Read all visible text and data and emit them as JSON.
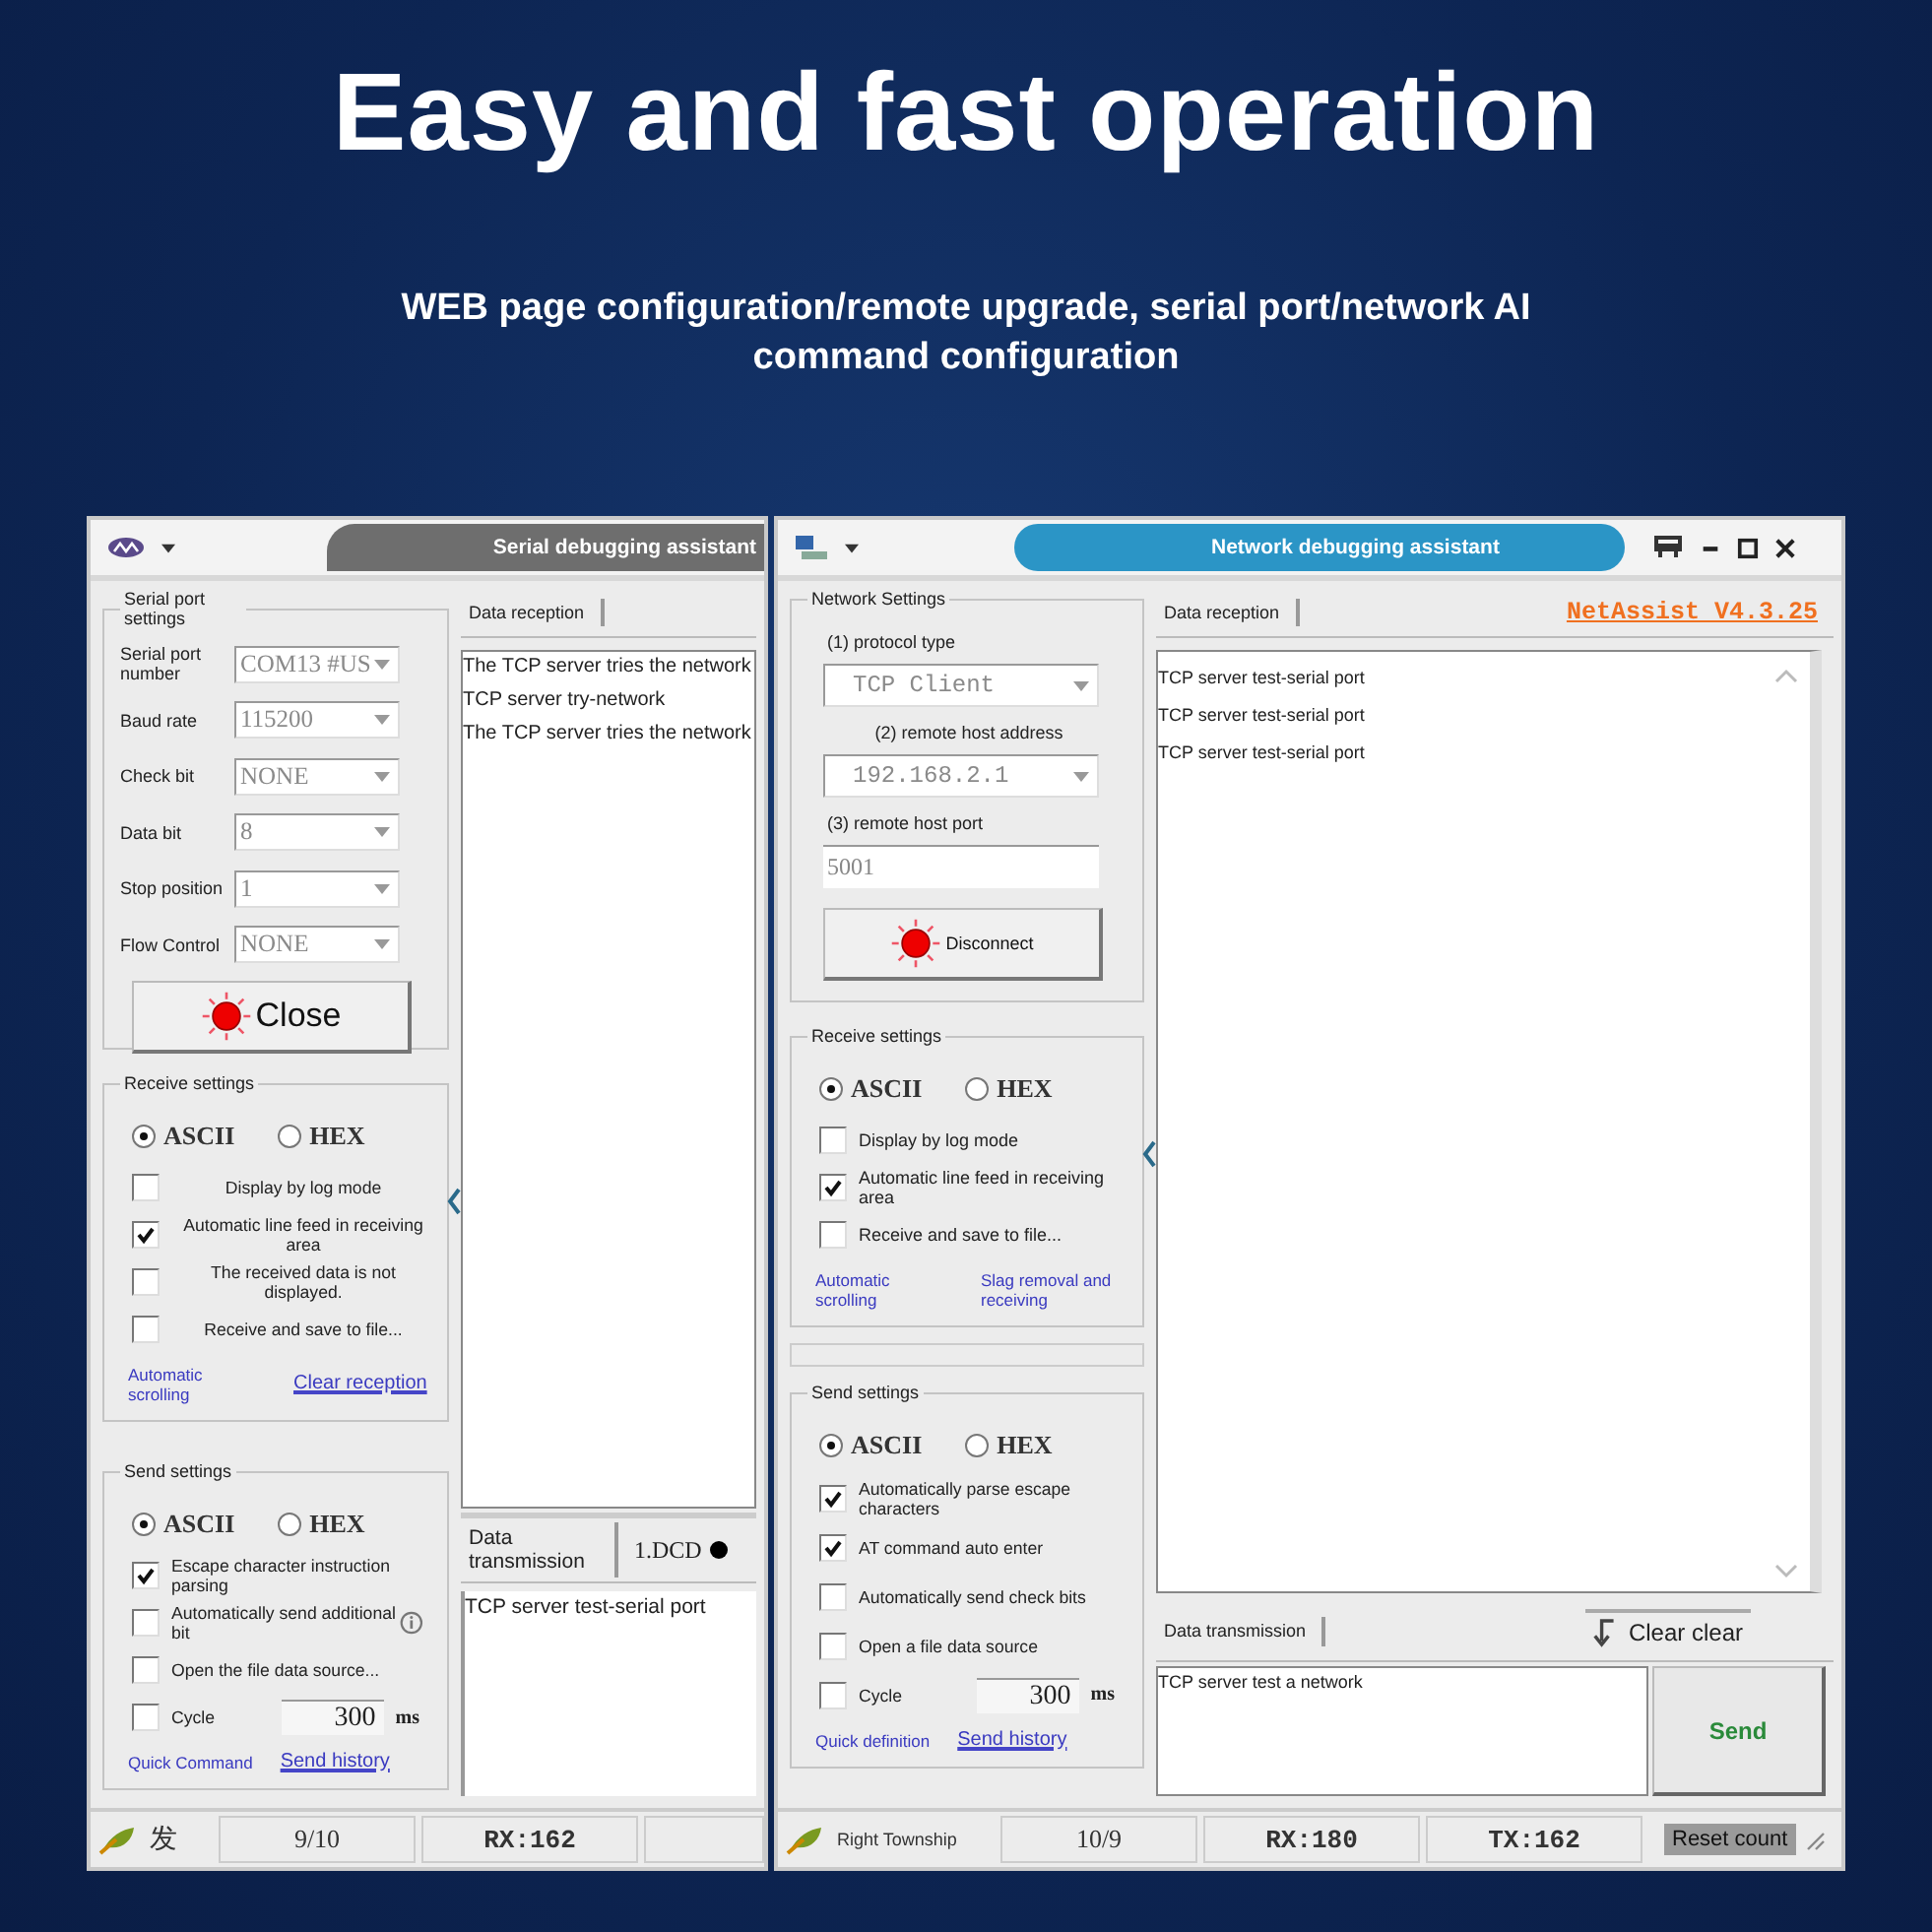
{
  "headline": "Easy and fast operation",
  "subtitle": "WEB page configuration/remote upgrade, serial port/network AI command configuration",
  "serial_window": {
    "title": "Serial debugging assistant",
    "port_settings": {
      "legend": "Serial port settings",
      "fields": [
        {
          "label": "Serial port number",
          "value": "COM13 #US"
        },
        {
          "label": "Baud rate",
          "value": "115200"
        },
        {
          "label": "Check bit",
          "value": "NONE"
        },
        {
          "label": "Data bit",
          "value": "8"
        },
        {
          "label": "Stop position",
          "value": "1"
        },
        {
          "label": "Flow Control",
          "value": "NONE"
        }
      ],
      "button": "Close"
    },
    "receive_settings": {
      "legend": "Receive settings",
      "modes": [
        {
          "label": "ASCII",
          "selected": true
        },
        {
          "label": "HEX",
          "selected": false
        }
      ],
      "options": [
        {
          "label": "Display by log mode",
          "checked": false
        },
        {
          "label": "Automatic line feed in receiving area",
          "checked": true
        },
        {
          "label": "The received data is not displayed.",
          "checked": false
        },
        {
          "label": "Receive and save to file...",
          "checked": false
        }
      ],
      "links": [
        {
          "label": "Automatic scrolling",
          "active": false
        },
        {
          "label": "Clear reception",
          "active": true
        }
      ]
    },
    "send_settings": {
      "legend": "Send settings",
      "modes": [
        {
          "label": "ASCII",
          "selected": true
        },
        {
          "label": "HEX",
          "selected": false
        }
      ],
      "options": [
        {
          "label": "Escape character instruction parsing",
          "checked": true
        },
        {
          "label": "Automatically send additional bit",
          "checked": false
        },
        {
          "label": "Open the file data source...",
          "checked": false
        }
      ],
      "cycle": {
        "label": "Cycle",
        "checked": false,
        "value": "300",
        "unit": "ms"
      },
      "links": [
        {
          "label": "Quick Command",
          "active": false
        },
        {
          "label": "Send history",
          "active": true
        }
      ]
    },
    "reception": {
      "tab": "Data reception",
      "lines": [
        "The TCP server tries the network",
        "TCP server try-network",
        "The TCP server tries the network"
      ]
    },
    "transmission": {
      "tab": "Data transmission",
      "port_status": "1.DCD",
      "text": "TCP server test-serial port"
    },
    "status_bar": [
      "发",
      "9/10",
      "RX:162"
    ]
  },
  "network_window": {
    "title": "Network debugging assistant",
    "version": "NetAssist V4.3.25",
    "network_settings": {
      "legend": "Network Settings",
      "fields": [
        {
          "label": "(1) protocol type",
          "value": "TCP Client",
          "kind": "dropdown"
        },
        {
          "label": "(2) remote host address",
          "value": "192.168.2.1",
          "kind": "dropdown"
        },
        {
          "label": "(3) remote host port",
          "value": "5001",
          "kind": "input"
        }
      ],
      "button": "Disconnect"
    },
    "receive_settings": {
      "legend": "Receive settings",
      "modes": [
        {
          "label": "ASCII",
          "selected": true
        },
        {
          "label": "HEX",
          "selected": false
        }
      ],
      "options": [
        {
          "label": "Display by log mode",
          "checked": false
        },
        {
          "label": "Automatic line feed in receiving area",
          "checked": true
        },
        {
          "label": "Receive and save to file...",
          "checked": false
        }
      ],
      "links": [
        {
          "label": "Automatic scrolling",
          "active": false
        },
        {
          "label": "Slag removal and receiving",
          "active": false
        }
      ]
    },
    "send_settings": {
      "legend": "Send settings",
      "modes": [
        {
          "label": "ASCII",
          "selected": true
        },
        {
          "label": "HEX",
          "selected": false
        }
      ],
      "options": [
        {
          "label": "Automatically parse escape characters",
          "checked": true
        },
        {
          "label": "AT command auto enter",
          "checked": true
        },
        {
          "label": "Automatically send check bits",
          "checked": false
        },
        {
          "label": "Open a file data source",
          "checked": false
        }
      ],
      "cycle": {
        "label": "Cycle",
        "checked": false,
        "value": "300",
        "unit": "ms"
      },
      "links": [
        {
          "label": "Quick definition",
          "active": false
        },
        {
          "label": "Send history",
          "active": true
        }
      ]
    },
    "reception": {
      "tab": "Data reception",
      "lines": [
        "TCP server test-serial port",
        "TCP server test-serial port",
        "TCP server test-serial port"
      ]
    },
    "transmission": {
      "tab": "Data transmission",
      "clear_button": "Clear clear",
      "text": "TCP server test a network",
      "send_button": "Send"
    },
    "status_bar": {
      "label": "Right Township",
      "count": "10/9",
      "rx": "RX:180",
      "tx": "TX:162",
      "reset_button": "Reset count"
    }
  }
}
